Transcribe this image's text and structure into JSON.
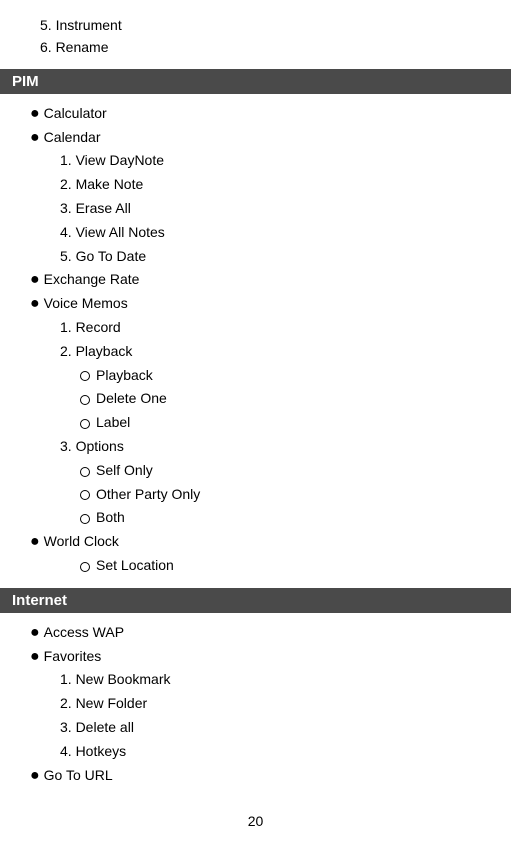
{
  "top": {
    "item5": "5. Instrument",
    "item6": "6. Rename"
  },
  "pim": {
    "header": "PIM",
    "items": [
      {
        "label": "Calculator",
        "subitems": []
      },
      {
        "label": "Calendar",
        "subitems": [
          {
            "label": "1. View DayNote"
          },
          {
            "label": "2. Make Note"
          },
          {
            "label": "3. Erase All"
          },
          {
            "label": "4. View All Notes"
          },
          {
            "label": "5. Go To Date"
          }
        ]
      },
      {
        "label": "Exchange Rate",
        "subitems": []
      },
      {
        "label": "Voice Memos",
        "subitems": [
          {
            "label": "1. Record"
          },
          {
            "label": "2. Playback",
            "subsubitems": [
              {
                "label": "Playback"
              },
              {
                "label": "Delete One"
              },
              {
                "label": "Label"
              }
            ]
          },
          {
            "label": "3. Options",
            "subsubitems": [
              {
                "label": "Self Only"
              },
              {
                "label": "Other Party Only"
              },
              {
                "label": "Both"
              }
            ]
          }
        ]
      },
      {
        "label": "World Clock",
        "subitems": [],
        "subsubitems": [
          {
            "label": "Set Location"
          }
        ]
      }
    ]
  },
  "internet": {
    "header": "Internet",
    "items": [
      {
        "label": "Access WAP",
        "subitems": []
      },
      {
        "label": "Favorites",
        "subitems": [
          {
            "label": "1. New Bookmark"
          },
          {
            "label": "2. New Folder"
          },
          {
            "label": "3. Delete all"
          },
          {
            "label": "4. Hotkeys"
          }
        ]
      },
      {
        "label": "Go To URL",
        "subitems": []
      }
    ]
  },
  "page_number": "20"
}
